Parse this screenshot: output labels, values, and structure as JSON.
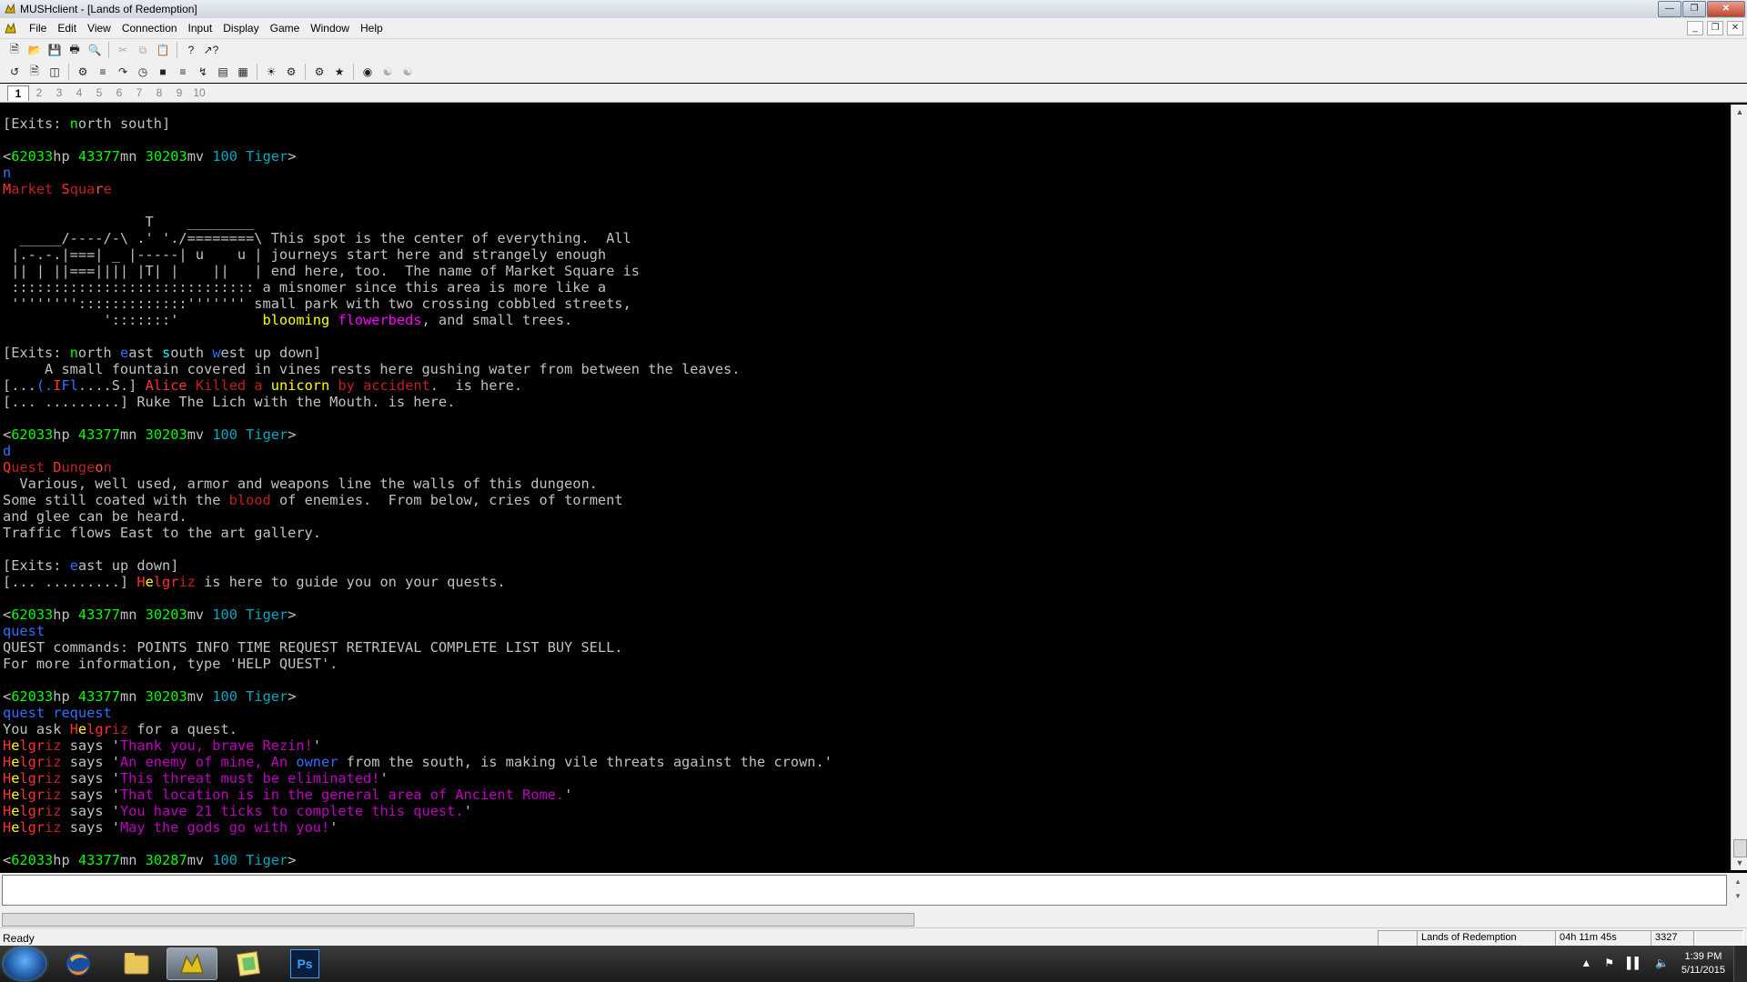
{
  "window": {
    "title": "MUSHclient - [Lands of Redemption]"
  },
  "menu": {
    "items": [
      "File",
      "Edit",
      "View",
      "Connection",
      "Input",
      "Display",
      "Game",
      "Window",
      "Help"
    ]
  },
  "toolbar1": [
    "new-icon",
    "open-icon",
    "save-icon",
    "print-icon",
    "print-preview-icon",
    "cut-icon",
    "copy-icon",
    "paste-icon",
    "help-icon",
    "context-help-icon"
  ],
  "toolbar2": [
    "connect-icon",
    "log-icon",
    "split-icon",
    "configure-icon",
    "triggers-icon",
    "aliases-icon",
    "timers-icon",
    "output-icon",
    "commands-icon",
    "macros-icon",
    "world-list-icon",
    "notepad-icon",
    "plugins-icon",
    "scripts-icon",
    "activity-icon",
    "find-icon",
    "user-icon",
    "users-icon"
  ],
  "world_tabs": {
    "items": [
      "1",
      "2",
      "3",
      "4",
      "5",
      "6",
      "7",
      "8",
      "9",
      "10"
    ],
    "active": "1"
  },
  "output": {
    "lines": [
      [
        [
          "[Exits: ",
          "#c0c0c0"
        ],
        [
          "n",
          "#00ff00"
        ],
        [
          "orth south]",
          "#c0c0c0"
        ]
      ],
      [],
      [
        [
          "<",
          "#c0c0c0"
        ],
        [
          "62033",
          "#00ff00"
        ],
        [
          "hp ",
          "#c0c0c0"
        ],
        [
          "43377",
          "#00ff00"
        ],
        [
          "mn ",
          "#c0c0c0"
        ],
        [
          "30203",
          "#00ff00"
        ],
        [
          "mv ",
          "#c0c0c0"
        ],
        [
          "100 Tiger",
          "#00a8c0"
        ],
        [
          ">",
          "#c0c0c0"
        ]
      ],
      [
        [
          "n",
          "#2f6fff"
        ]
      ],
      [
        [
          "M",
          "#ff3030"
        ],
        [
          "arket ",
          "#c02020"
        ],
        [
          "S",
          "#ff3030"
        ],
        [
          "qua",
          "#c02020"
        ],
        [
          "r",
          "#ff5050"
        ],
        [
          "e",
          "#c02020"
        ]
      ],
      [],
      [
        [
          "                 T    ________",
          "#c0c0c0"
        ]
      ],
      [
        [
          "  _____/----/-\\ .' './========\\ ",
          "#c0c0c0"
        ],
        [
          "This spot is the center of everything.  All",
          "#c0c0c0"
        ]
      ],
      [
        [
          " |.-.-.|===| _ |-----| u    u | ",
          "#c0c0c0"
        ],
        [
          "journeys start here and strangely enough",
          "#c0c0c0"
        ]
      ],
      [
        [
          " || | ||===|||| |T| |    ||   | ",
          "#c0c0c0"
        ],
        [
          "end here, too.  The name of Market Square is",
          "#c0c0c0"
        ]
      ],
      [
        [
          " ::::::::::::::::::::::::::::: ",
          "#c0c0c0"
        ],
        [
          "a misnomer since this area is more like a",
          "#c0c0c0"
        ]
      ],
      [
        [
          " '''''''':::::::::::::''''''' ",
          "#c0c0c0"
        ],
        [
          "small park with two crossing cobbled streets,",
          "#c0c0c0"
        ]
      ],
      [
        [
          "            ':::::::'          ",
          "#c0c0c0"
        ],
        [
          "blooming ",
          "#ffff00"
        ],
        [
          "flowerbeds",
          "#ff00ff"
        ],
        [
          ", and small trees.",
          "#c0c0c0"
        ]
      ],
      [],
      [
        [
          "[Exits: ",
          "#c0c0c0"
        ],
        [
          "n",
          "#00ff00"
        ],
        [
          "orth ",
          "#c0c0c0"
        ],
        [
          "e",
          "#2f6fff"
        ],
        [
          "ast ",
          "#c0c0c0"
        ],
        [
          "s",
          "#00ffff"
        ],
        [
          "outh ",
          "#c0c0c0"
        ],
        [
          "w",
          "#2f6fff"
        ],
        [
          "est up down]",
          "#c0c0c0"
        ]
      ],
      [
        [
          "     A small fountain covered in vines rests here gushing water from between the leaves.",
          "#c0c0c0"
        ]
      ],
      [
        [
          "[...",
          "#c0c0c0"
        ],
        [
          "(.",
          "#2f6fff"
        ],
        [
          "I",
          "#ff3030"
        ],
        [
          "Fl",
          "#2f6fff"
        ],
        [
          "....S.] ",
          "#c0c0c0"
        ],
        [
          "Alice ",
          "#ff3030"
        ],
        [
          "Killed a ",
          "#c02020"
        ],
        [
          "unicorn ",
          "#ffff00"
        ],
        [
          "by accident",
          "#c02020"
        ],
        [
          ".  is here.",
          "#c0c0c0"
        ]
      ],
      [
        [
          "[... .........] Ruke The Lich with the Mouth. is here.",
          "#c0c0c0"
        ]
      ],
      [],
      [
        [
          "<",
          "#c0c0c0"
        ],
        [
          "62033",
          "#00ff00"
        ],
        [
          "hp ",
          "#c0c0c0"
        ],
        [
          "43377",
          "#00ff00"
        ],
        [
          "mn ",
          "#c0c0c0"
        ],
        [
          "30203",
          "#00ff00"
        ],
        [
          "mv ",
          "#c0c0c0"
        ],
        [
          "100 Tiger",
          "#00a8c0"
        ],
        [
          ">",
          "#c0c0c0"
        ]
      ],
      [
        [
          "d",
          "#2f6fff"
        ]
      ],
      [
        [
          "Q",
          "#ff3030"
        ],
        [
          "uest ",
          "#c02020"
        ],
        [
          "D",
          "#ff3030"
        ],
        [
          "unge",
          "#c02020"
        ],
        [
          "o",
          "#ff5050"
        ],
        [
          "n",
          "#c02020"
        ]
      ],
      [
        [
          "  Various, well used, armor and weapons line the walls of this dungeon.",
          "#c0c0c0"
        ]
      ],
      [
        [
          "Some still coated with the ",
          "#c0c0c0"
        ],
        [
          "blood",
          "#c02020"
        ],
        [
          " of enemies.  From below, cries of torment",
          "#c0c0c0"
        ]
      ],
      [
        [
          "and glee can be heard.",
          "#c0c0c0"
        ]
      ],
      [
        [
          "Traffic flows East to the art gallery.",
          "#c0c0c0"
        ]
      ],
      [],
      [
        [
          "[Exits: ",
          "#c0c0c0"
        ],
        [
          "e",
          "#2f6fff"
        ],
        [
          "ast up down]",
          "#c0c0c0"
        ]
      ],
      [
        [
          "[... .........] ",
          "#c0c0c0"
        ],
        [
          "H",
          "#ff3030"
        ],
        [
          "e",
          "#ffff00"
        ],
        [
          "lgr",
          "#ff3030"
        ],
        [
          "iz",
          "#c02020"
        ],
        [
          " is here to guide you on your quests.",
          "#c0c0c0"
        ]
      ],
      [],
      [
        [
          "<",
          "#c0c0c0"
        ],
        [
          "62033",
          "#00ff00"
        ],
        [
          "hp ",
          "#c0c0c0"
        ],
        [
          "43377",
          "#00ff00"
        ],
        [
          "mn ",
          "#c0c0c0"
        ],
        [
          "30203",
          "#00ff00"
        ],
        [
          "mv ",
          "#c0c0c0"
        ],
        [
          "100 Tiger",
          "#00a8c0"
        ],
        [
          ">",
          "#c0c0c0"
        ]
      ],
      [
        [
          "quest",
          "#2f6fff"
        ]
      ],
      [
        [
          "QUEST commands: POINTS INFO TIME REQUEST RETRIEVAL COMPLETE LIST BUY SELL.",
          "#c0c0c0"
        ]
      ],
      [
        [
          "For more information, type 'HELP QUEST'.",
          "#c0c0c0"
        ]
      ],
      [],
      [
        [
          "<",
          "#c0c0c0"
        ],
        [
          "62033",
          "#00ff00"
        ],
        [
          "hp ",
          "#c0c0c0"
        ],
        [
          "43377",
          "#00ff00"
        ],
        [
          "mn ",
          "#c0c0c0"
        ],
        [
          "30203",
          "#00ff00"
        ],
        [
          "mv ",
          "#c0c0c0"
        ],
        [
          "100 Tiger",
          "#00a8c0"
        ],
        [
          ">",
          "#c0c0c0"
        ]
      ],
      [
        [
          "quest request",
          "#2f6fff"
        ]
      ],
      [
        [
          "You ask ",
          "#c0c0c0"
        ],
        [
          "H",
          "#ff3030"
        ],
        [
          "e",
          "#ffff00"
        ],
        [
          "lgr",
          "#ff3030"
        ],
        [
          "iz",
          "#c02020"
        ],
        [
          " for a quest.",
          "#c0c0c0"
        ]
      ],
      [
        [
          "H",
          "#ff3030"
        ],
        [
          "e",
          "#ffff00"
        ],
        [
          "lgr",
          "#ff3030"
        ],
        [
          "iz",
          "#c02020"
        ],
        [
          " says '",
          "#c0c0c0"
        ],
        [
          "Thank you, brave Rezin!",
          "#c000c0"
        ],
        [
          "'",
          "#c0c0c0"
        ]
      ],
      [
        [
          "H",
          "#ff3030"
        ],
        [
          "e",
          "#ffff00"
        ],
        [
          "lgr",
          "#ff3030"
        ],
        [
          "iz",
          "#c02020"
        ],
        [
          " says '",
          "#c0c0c0"
        ],
        [
          "An enemy of mine, An ",
          "#c000c0"
        ],
        [
          "owner",
          "#2f6fff"
        ],
        [
          " from the south, is making vile threats against the crown.",
          "#c0c0c0"
        ],
        [
          "'",
          "#c0c0c0"
        ]
      ],
      [
        [
          "H",
          "#ff3030"
        ],
        [
          "e",
          "#ffff00"
        ],
        [
          "lgr",
          "#ff3030"
        ],
        [
          "iz",
          "#c02020"
        ],
        [
          " says '",
          "#c0c0c0"
        ],
        [
          "This threat must be eliminated!",
          "#c000c0"
        ],
        [
          "'",
          "#c0c0c0"
        ]
      ],
      [
        [
          "H",
          "#ff3030"
        ],
        [
          "e",
          "#ffff00"
        ],
        [
          "lgr",
          "#ff3030"
        ],
        [
          "iz",
          "#c02020"
        ],
        [
          " says '",
          "#c0c0c0"
        ],
        [
          "That location is in the general area of Ancient Rome.",
          "#c000c0"
        ],
        [
          "'",
          "#c0c0c0"
        ]
      ],
      [
        [
          "H",
          "#ff3030"
        ],
        [
          "e",
          "#ffff00"
        ],
        [
          "lgr",
          "#ff3030"
        ],
        [
          "iz",
          "#c02020"
        ],
        [
          " says '",
          "#c0c0c0"
        ],
        [
          "You have 21 ticks to complete this quest.",
          "#c000c0"
        ],
        [
          "'",
          "#c0c0c0"
        ]
      ],
      [
        [
          "H",
          "#ff3030"
        ],
        [
          "e",
          "#ffff00"
        ],
        [
          "lgr",
          "#ff3030"
        ],
        [
          "iz",
          "#c02020"
        ],
        [
          " says '",
          "#c0c0c0"
        ],
        [
          "May the gods go with you!",
          "#c000c0"
        ],
        [
          "'",
          "#c0c0c0"
        ]
      ],
      [],
      [
        [
          "<",
          "#c0c0c0"
        ],
        [
          "62033",
          "#00ff00"
        ],
        [
          "hp ",
          "#c0c0c0"
        ],
        [
          "43377",
          "#00ff00"
        ],
        [
          "mn ",
          "#c0c0c0"
        ],
        [
          "30287",
          "#00ff00"
        ],
        [
          "mv ",
          "#c0c0c0"
        ],
        [
          "100 Tiger",
          "#00a8c0"
        ],
        [
          ">",
          "#c0c0c0"
        ]
      ]
    ]
  },
  "command_input": {
    "value": "",
    "placeholder": ""
  },
  "scroll": {
    "vertical_position": 1.0,
    "horizontal_visible_fraction": 0.52
  },
  "status": {
    "ready": "Ready",
    "world": "Lands of Redemption",
    "time": "04h 11m 45s",
    "lines": "3327"
  },
  "taskbar": {
    "apps": [
      "firefox-icon",
      "file-explorer-icon",
      "mushclient-icon",
      "notes-icon",
      "photoshop-icon"
    ],
    "photoshop_label": "Ps",
    "clock_time": "1:39 PM",
    "clock_date": "5/11/2015"
  }
}
